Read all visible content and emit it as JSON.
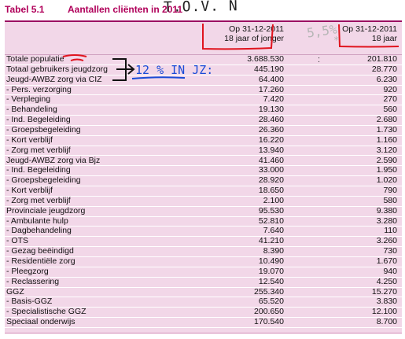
{
  "title": {
    "number": "Tabel 5.1",
    "text": "Aantallen cliënten in 2011",
    "handwritten": "T.O.V. N̄"
  },
  "header": {
    "col1_line1": "Op 31-12-2011",
    "col1_line2": "18 jaar of jonger",
    "col2_line1": "Op 31-12-2011",
    "col2_line2": "18 jaar",
    "handwritten_percent": "5,5%",
    "handwritten_star": "*"
  },
  "annotations": {
    "handwritten_note": "12 % IN JZ:",
    "colon_mark": ":"
  },
  "rows": [
    {
      "label": "Totale populatie",
      "v1": "3.688.530",
      "v2": "201.810"
    },
    {
      "label": "Totaal gebruikers jeugdzorg",
      "v1": "445.190",
      "v2": "28.770"
    },
    {
      "label": "Jeugd-AWBZ zorg via CIZ",
      "v1": "64.400",
      "v2": "6.230"
    },
    {
      "label": "- Pers. verzorging",
      "v1": "17.260",
      "v2": "920"
    },
    {
      "label": "- Verpleging",
      "v1": "7.420",
      "v2": "270"
    },
    {
      "label": "- Behandeling",
      "v1": "19.130",
      "v2": "560"
    },
    {
      "label": "- Ind. Begeleiding",
      "v1": "28.460",
      "v2": "2.680"
    },
    {
      "label": "- Groepsbegeleiding",
      "v1": "26.360",
      "v2": "1.730"
    },
    {
      "label": "- Kort verblijf",
      "v1": "16.220",
      "v2": "1.160"
    },
    {
      "label": "- Zorg met verblijf",
      "v1": "13.940",
      "v2": "3.120"
    },
    {
      "label": "Jeugd-AWBZ zorg via Bjz",
      "v1": "41.460",
      "v2": "2.590"
    },
    {
      "label": "- Ind. Begeleiding",
      "v1": "33.000",
      "v2": "1.950"
    },
    {
      "label": "- Groepsbegeleiding",
      "v1": "28.920",
      "v2": "1.020"
    },
    {
      "label": "- Kort verblijf",
      "v1": "18.650",
      "v2": "790"
    },
    {
      "label": "- Zorg met verblijf",
      "v1": "2.100",
      "v2": "580"
    },
    {
      "label": "Provinciale jeugdzorg",
      "v1": "95.530",
      "v2": "9.380"
    },
    {
      "label": "- Ambulante hulp",
      "v1": "52.810",
      "v2": "3.280"
    },
    {
      "label": "- Dagbehandeling",
      "v1": "7.640",
      "v2": "110"
    },
    {
      "label": "- OTS",
      "v1": "41.210",
      "v2": "3.260"
    },
    {
      "label": "- Gezag beëindigd",
      "v1": "8.390",
      "v2": "730"
    },
    {
      "label": "- Residentiële zorg",
      "v1": "10.490",
      "v2": "1.670"
    },
    {
      "label": "- Pleegzorg",
      "v1": "19.070",
      "v2": "940"
    },
    {
      "label": "- Reclassering",
      "v1": "12.540",
      "v2": "4.250"
    },
    {
      "label": "GGZ",
      "v1": "255.340",
      "v2": "15.270"
    },
    {
      "label": "- Basis-GGZ",
      "v1": "65.520",
      "v2": "3.830"
    },
    {
      "label": "- Specialistische GGZ",
      "v1": "200.650",
      "v2": "12.100"
    },
    {
      "label": "Speciaal onderwijs",
      "v1": "170.540",
      "v2": "8.700"
    }
  ],
  "colors": {
    "title": "#b0005a",
    "table_bg": "#f2d7e8",
    "top_rule": "#9b0f62",
    "ink_red": "#e0141e",
    "ink_blue": "#1a4bd6"
  }
}
